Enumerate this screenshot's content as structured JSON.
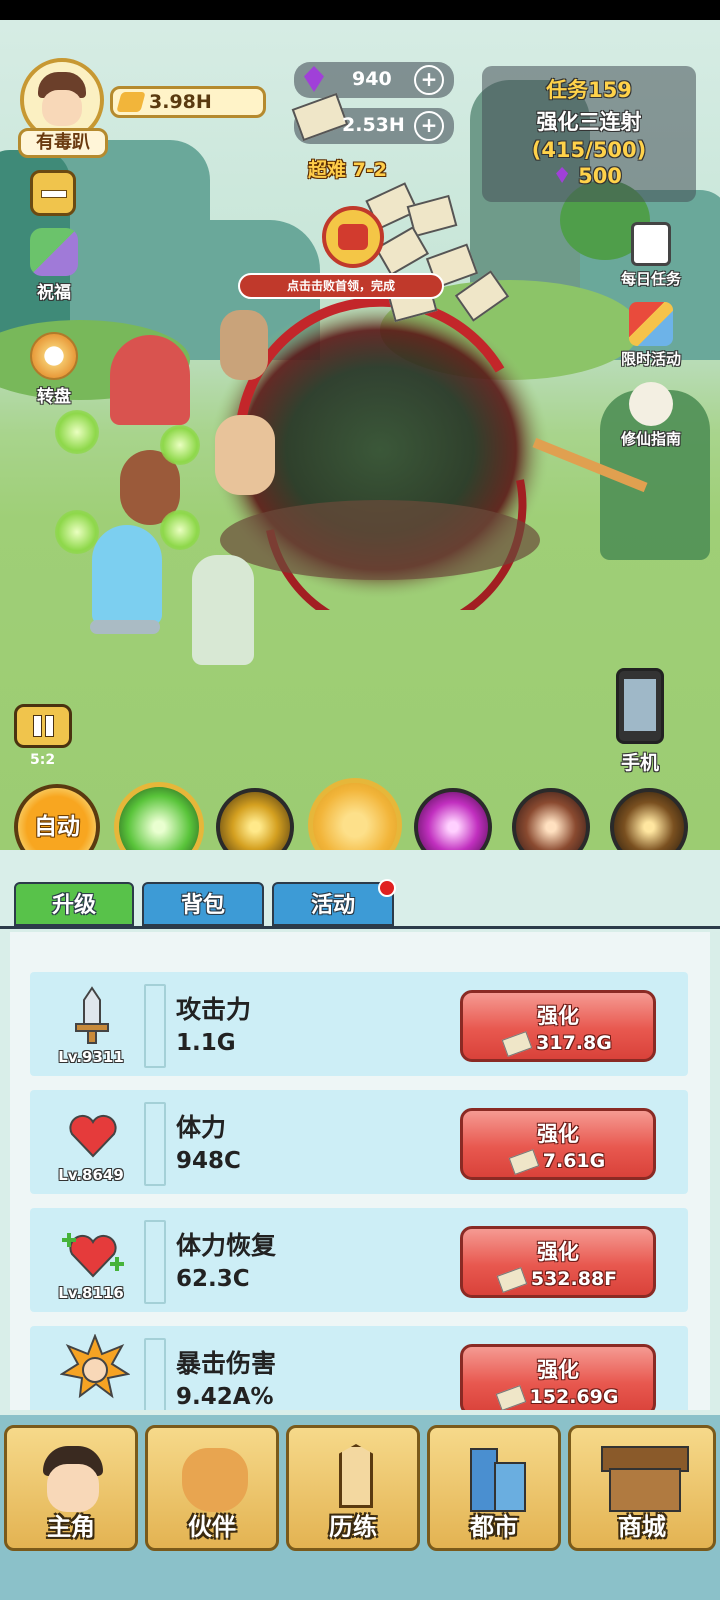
{
  "player": {
    "name": "有毒趴",
    "power": "3.98H"
  },
  "currency": {
    "gems": "940",
    "cash": "2.53H"
  },
  "stage": "超难 7-2",
  "task": {
    "title": "任务159",
    "name": "强化三连射",
    "progress": "(415/500)",
    "reward": "500"
  },
  "boss_banner": "点击击败首领，完成",
  "left_menu": {
    "blessing": "祝福",
    "wheel": "转盘"
  },
  "right_menu": {
    "daily": "每日任务",
    "limited": "限时活动",
    "guide": "修仙指南",
    "phone": "手机"
  },
  "speed": {
    "label": "5:2"
  },
  "auto_label": "自动",
  "tabs": [
    {
      "label": "升级"
    },
    {
      "label": "背包"
    },
    {
      "label": "活动"
    }
  ],
  "upgrades": [
    {
      "name": "攻击力",
      "value": "1.1G",
      "level": "Lv.9311",
      "button": "强化",
      "cost": "317.8G",
      "icon": "sword-icon"
    },
    {
      "name": "体力",
      "value": "948C",
      "level": "Lv.8649",
      "button": "强化",
      "cost": "7.61G",
      "icon": "heart-icon"
    },
    {
      "name": "体力恢复",
      "value": "62.3C",
      "level": "Lv.8116",
      "button": "强化",
      "cost": "532.88F",
      "icon": "heart-plus-icon"
    },
    {
      "name": "暴击伤害",
      "value": "9.42A%",
      "level": "",
      "button": "强化",
      "cost": "152.69G",
      "icon": "fist-icon"
    }
  ],
  "nav": [
    {
      "label": "主角",
      "icon": "hero-icon"
    },
    {
      "label": "伙伴",
      "icon": "cat-icon"
    },
    {
      "label": "历练",
      "icon": "sign-icon"
    },
    {
      "label": "都市",
      "icon": "city-icon"
    },
    {
      "label": "商城",
      "icon": "shop-icon"
    }
  ],
  "colors": {
    "accent_green": "#58c24a",
    "tab_blue": "#3d9bd6",
    "upgrade_red": "#e8584f",
    "gold": "#f2b53a"
  }
}
